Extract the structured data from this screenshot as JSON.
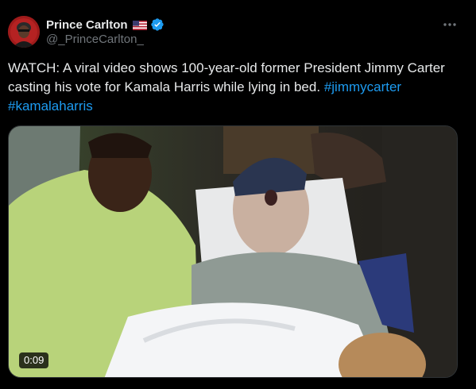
{
  "author": {
    "display_name": "Prince Carlton",
    "handle": "@_PrinceCarlton_",
    "flag": "us-flag-icon",
    "verified": "verified-badge-icon"
  },
  "tweet": {
    "text": "WATCH: A viral video shows 100-year-old former President Jimmy Carter casting his vote for Kamala Harris while lying in bed.",
    "hashtags": [
      "#jimmycarter",
      "#kamalaharris"
    ]
  },
  "media": {
    "type": "video",
    "duration": "0:09"
  },
  "colors": {
    "background": "#000000",
    "text": "#e7e9ea",
    "muted": "#71767b",
    "accent": "#1d9bf0"
  }
}
